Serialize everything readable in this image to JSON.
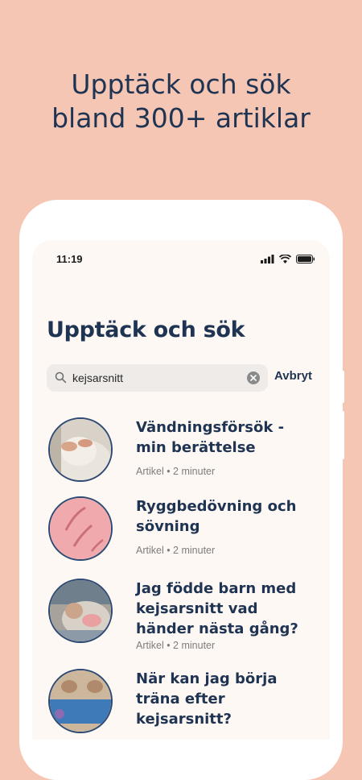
{
  "promo": {
    "line1": "Upptäck och sök",
    "line2": "bland 300+ artiklar"
  },
  "status_bar": {
    "time": "11:19",
    "icons": [
      "signal-icon",
      "wifi-icon",
      "battery-icon"
    ]
  },
  "page": {
    "title": "Upptäck och sök"
  },
  "search": {
    "value": "kejsarsnitt",
    "cancel_label": "Avbryt"
  },
  "articles": [
    {
      "title": "Vändningsförsök - min berättelse",
      "meta": "Artikel • 2 minuter"
    },
    {
      "title": "Ryggbedövning och sövning",
      "meta": "Artikel • 2 minuter"
    },
    {
      "title": "Jag födde barn med kejsarsnitt vad händer nästa gång?",
      "meta": "Artikel • 2 minuter"
    },
    {
      "title": "När kan jag börja träna efter kejsarsnitt?",
      "meta": ""
    }
  ],
  "colors": {
    "background": "#f5c6b3",
    "navy": "#1f3452",
    "screen": "#fdf8f4"
  }
}
